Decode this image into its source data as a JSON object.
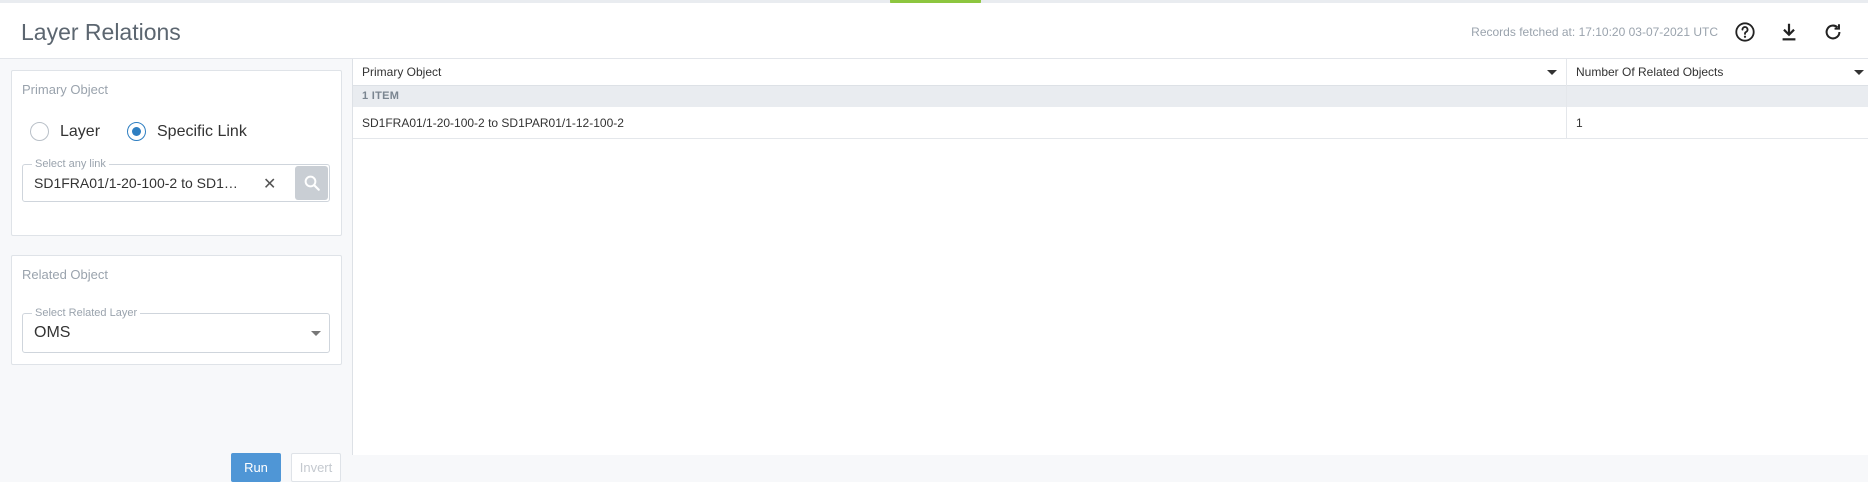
{
  "header": {
    "title": "Layer Relations",
    "records_fetched": "Records fetched at: 17:10:20 03-07-2021 UTC",
    "icons": [
      "help-icon",
      "download-icon",
      "refresh-icon"
    ]
  },
  "primary_object": {
    "title": "Primary Object",
    "options": [
      "Layer",
      "Specific Link"
    ],
    "selected": "Specific Link",
    "link_field": {
      "legend": "Select any link",
      "value": "SD1FRA01/1-20-100-2 to SD1…",
      "clear_symbol": "✕"
    }
  },
  "related_object": {
    "title": "Related Object",
    "layer_field": {
      "legend": "Select Related Layer",
      "value": "OMS"
    }
  },
  "actions": {
    "run_label": "Run",
    "invert_label": "Invert"
  },
  "grid": {
    "columns": [
      "Primary Object",
      "Number Of Related Objects"
    ],
    "group_label": "1 ITEM",
    "rows": [
      {
        "primary": "SD1FRA01/1-20-100-2 to SD1PAR01/1-12-100-2",
        "count": "1"
      }
    ]
  },
  "colors": {
    "accent": "#2f7fc2",
    "run_button": "#4f96d6",
    "top_tab": "#8dc63f"
  }
}
